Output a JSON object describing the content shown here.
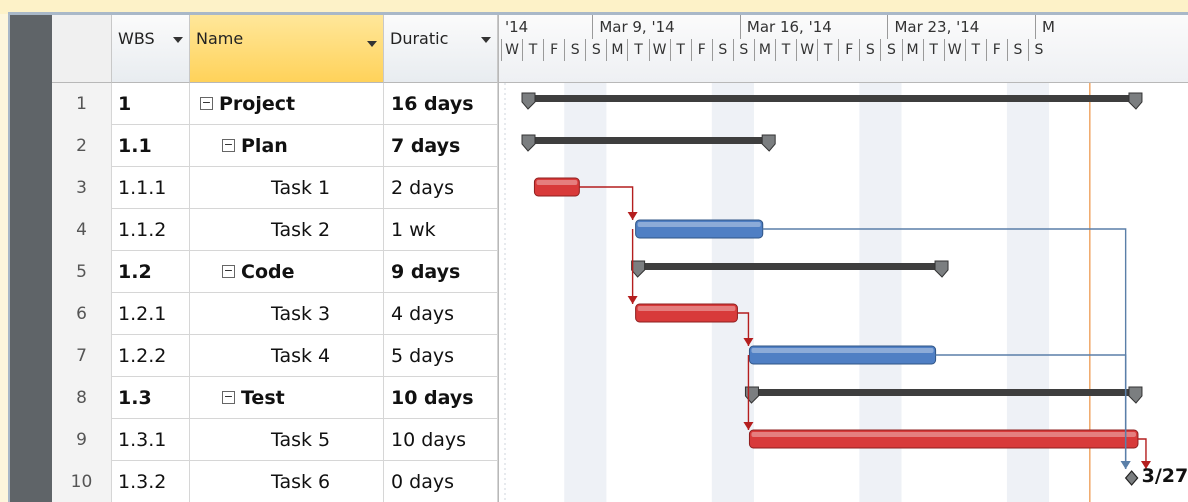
{
  "columns": {
    "wbs": "WBS",
    "name": "Name",
    "duration": "Duratic"
  },
  "rows": [
    {
      "id": "1",
      "wbs": "1",
      "name": "Project",
      "duration": "16 days",
      "summary": true,
      "level": 0
    },
    {
      "id": "2",
      "wbs": "1.1",
      "name": "Plan",
      "duration": "7 days",
      "summary": true,
      "level": 1
    },
    {
      "id": "3",
      "wbs": "1.1.1",
      "name": "Task 1",
      "duration": "2 days",
      "summary": false,
      "level": 2
    },
    {
      "id": "4",
      "wbs": "1.1.2",
      "name": "Task 2",
      "duration": "1 wk",
      "summary": false,
      "level": 2
    },
    {
      "id": "5",
      "wbs": "1.2",
      "name": "Code",
      "duration": "9 days",
      "summary": true,
      "level": 1
    },
    {
      "id": "6",
      "wbs": "1.2.1",
      "name": "Task 3",
      "duration": "4 days",
      "summary": false,
      "level": 2
    },
    {
      "id": "7",
      "wbs": "1.2.2",
      "name": "Task 4",
      "duration": "5 days",
      "summary": false,
      "level": 2
    },
    {
      "id": "8",
      "wbs": "1.3",
      "name": "Test",
      "duration": "10 days",
      "summary": true,
      "level": 1
    },
    {
      "id": "9",
      "wbs": "1.3.1",
      "name": "Task 5",
      "duration": "10 days",
      "summary": false,
      "level": 2
    },
    {
      "id": "10",
      "wbs": "1.3.2",
      "name": "Task 6",
      "duration": "0 days",
      "summary": false,
      "level": 2
    }
  ],
  "timeline": {
    "weeks": [
      "'14",
      "Mar 9, '14",
      "Mar 16, '14",
      "Mar 23, '14",
      "M"
    ],
    "day_letters": [
      "W",
      "T",
      "F",
      "S",
      "S",
      "M",
      "T",
      "W",
      "T",
      "F",
      "S",
      "S",
      "M",
      "T",
      "W",
      "T",
      "F",
      "S",
      "S",
      "M",
      "T",
      "W",
      "T",
      "F",
      "S",
      "S"
    ]
  },
  "bars": [
    {
      "row": 0,
      "kind": "summary",
      "start_day": 0,
      "end_day": 29.6
    },
    {
      "row": 1,
      "kind": "summary",
      "start_day": 0,
      "end_day": 12.2
    },
    {
      "row": 2,
      "kind": "critical",
      "start_day": 0.4,
      "end_day": 3.1
    },
    {
      "row": 3,
      "kind": "normal",
      "start_day": 5.2,
      "end_day": 11.8
    },
    {
      "row": 4,
      "kind": "summary",
      "start_day": 5.2,
      "end_day": 20.4
    },
    {
      "row": 5,
      "kind": "critical",
      "start_day": 5.2,
      "end_day": 10.6
    },
    {
      "row": 6,
      "kind": "normal",
      "start_day": 10.6,
      "end_day": 20.0
    },
    {
      "row": 7,
      "kind": "summary",
      "start_day": 10.6,
      "end_day": 29.6
    },
    {
      "row": 8,
      "kind": "critical",
      "start_day": 10.6,
      "end_day": 29.6
    }
  ],
  "milestone": {
    "row": 9,
    "day": 29.3,
    "label": "3/27"
  },
  "status_line_day": 27.6,
  "colors": {
    "critical": "#d83a3a",
    "normal": "#4f7fc4",
    "summary": "#3e3e3e",
    "link_red": "#b41e1e",
    "link_blue": "#5a7fa8",
    "status_line": "#f0a868",
    "weekend_shade": "#eef1f6"
  }
}
